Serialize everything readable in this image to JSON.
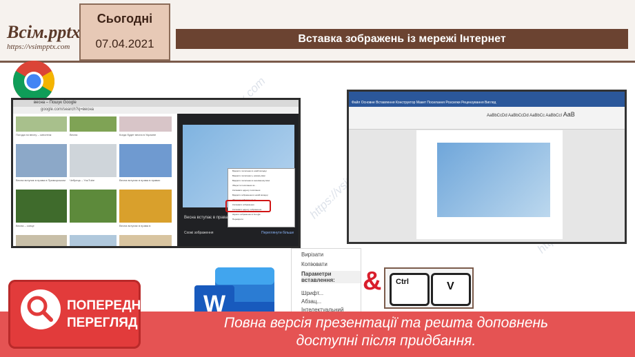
{
  "header": {
    "logo_title": "Всім.pptx",
    "logo_url": "https://vsimpptx.com",
    "date_label": "Сьогодні",
    "date_value": "07.04.2021",
    "slide_title": "Вставка зображень із мережі Інтернет"
  },
  "browser_shot": {
    "tab_title": "весна – Пошук Google",
    "address": "google.com/search?q=весна",
    "context_menu_items": [
      "Відкрити посилання в новій вкладці",
      "Відкрити посилання у новому вікні",
      "Відкрити посилання в анонімному вікні",
      "Зберегти посилання як...",
      "Копіювати адресу посилання",
      "Відкрити зображення в новій вкладці",
      "Зберегти зображення як...",
      "Копіювати зображення",
      "Копіювати адресу зображення",
      "Шукати зображення в Google",
      "Перевірити"
    ],
    "highlighted_item": "Копіювати зображення",
    "thumb_captions": [
      "Погода на весну – синоптик",
      "Весна",
      "Когда будет весна в Украине",
      "Весна вступає в права в Приморськом",
      "Чебрець – YouTube",
      "Весна вступає в права в правах",
      "Весна – сонце",
      "Весна вступає в права в"
    ],
    "panel_caption": "Весна вступає в права в",
    "panel_subcaption": "Схожі зображення",
    "panel_more": "Переглянути більше"
  },
  "word_shot": {
    "tabs": [
      "Файл",
      "Основне",
      "Вставлення",
      "Конструктор",
      "Макет",
      "Посилання",
      "Розсилки",
      "Рецензування",
      "Вигляд"
    ],
    "style_samples": [
      "AaBbCcDd",
      "AaBbCcDd",
      "AaBbCc",
      "AaBbCcI",
      "AaB"
    ]
  },
  "paste_menu": {
    "items": [
      "Вирізати",
      "Копіювати",
      "Параметри вставлення:",
      "Шрифт...",
      "Абзац...",
      "Інтелектуальний пошук"
    ]
  },
  "shortcut": {
    "amp": "&",
    "key1": "Ctrl",
    "key2": "V"
  },
  "preview": {
    "line1": "ПОПЕРЕДНІЙ",
    "line2": "ПЕРЕГЛЯД"
  },
  "banner": {
    "line1": "Повна версія презентації та решта доповнень",
    "line2": "доступні після придбання."
  },
  "colors": {
    "title_bar": "#6b4331",
    "banner": "#e55353",
    "date_box": "#e7c9b6",
    "accent_red": "#d91e2c"
  }
}
